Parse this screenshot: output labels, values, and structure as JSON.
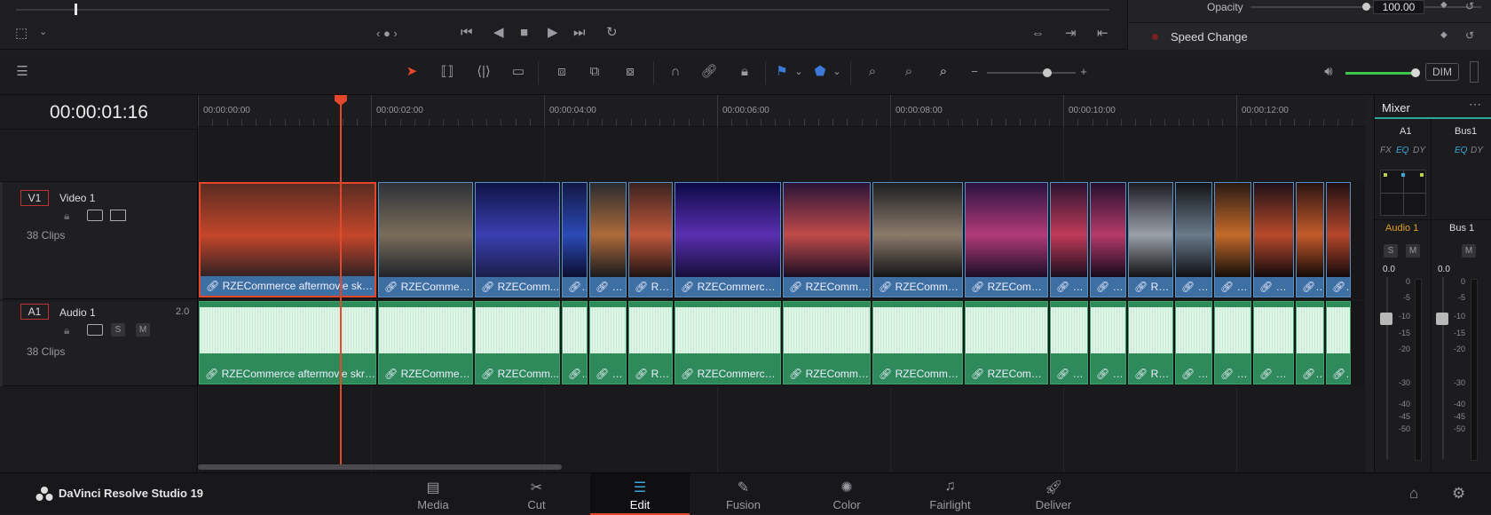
{
  "inspector": {
    "opacity_label": "Opacity",
    "opacity_value": "100.00",
    "speed_change_label": "Speed Change"
  },
  "toolbar": {
    "dim_label": "DIM"
  },
  "timeline": {
    "current_timecode": "00:00:01:16",
    "ruler_labels": [
      "00:00:00:00",
      "00:00:02:00",
      "00:00:04:00",
      "00:00:06:00",
      "00:00:08:00",
      "00:00:10:00",
      "00:00:12:00"
    ],
    "video_track": {
      "id": "V1",
      "name": "Video 1",
      "clip_count": "38 Clips"
    },
    "audio_track": {
      "id": "A1",
      "name": "Audio 1",
      "level": "2.0",
      "clip_count": "38 Clips",
      "solo": "S",
      "mute": "M"
    },
    "clips": [
      "RZECommerce aftermovie skrot...",
      "RZECommerc...",
      "RZEComm...",
      "RZ...",
      "RZEC...",
      "RZ...",
      "RZECommerce a...",
      "RZECommerce...",
      "RZECommer...",
      "RZEComm...",
      "RZEC...",
      "RZEC...",
      "RZEC...",
      "RZEC...",
      "RZEC...",
      "RZEC...",
      "R...",
      "R..."
    ],
    "playhead_seconds": 1.64
  },
  "mixer": {
    "title": "Mixer",
    "ch1_name": "A1",
    "ch2_name": "Bus1",
    "fx": "FX",
    "eq": "EQ",
    "dy": "DY",
    "ch1_label": "Audio 1",
    "ch2_label": "Bus 1",
    "solo": "S",
    "mute": "M",
    "ch1_level": "0.0",
    "ch2_level": "0.0",
    "scale": [
      "0",
      "-5",
      "-10",
      "-15",
      "-20",
      "-30",
      "-40",
      "-45",
      "-50"
    ]
  },
  "app": {
    "name": "DaVinci Resolve Studio 19"
  },
  "pages": [
    {
      "label": "Media",
      "icon": "media-icon"
    },
    {
      "label": "Cut",
      "icon": "cut-icon"
    },
    {
      "label": "Edit",
      "icon": "edit-icon",
      "active": true
    },
    {
      "label": "Fusion",
      "icon": "fusion-icon"
    },
    {
      "label": "Color",
      "icon": "color-icon"
    },
    {
      "label": "Fairlight",
      "icon": "fairlight-icon"
    },
    {
      "label": "Deliver",
      "icon": "deliver-icon"
    }
  ],
  "colors": {
    "accent": "#e5472c",
    "video_clip": "#3d6fa3",
    "audio_clip": "#2e8a5a",
    "meter_green": "#3bc54a"
  }
}
